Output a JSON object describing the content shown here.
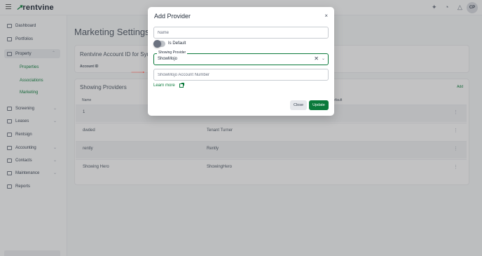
{
  "topbar": {
    "logo": "rentvine",
    "avatar_initials": "CP"
  },
  "sidebar": {
    "items": [
      {
        "label": "Dashboard"
      },
      {
        "label": "Portfolios"
      },
      {
        "label": "Property"
      },
      {
        "label": "Screening"
      },
      {
        "label": "Leases"
      },
      {
        "label": "Rentsign"
      },
      {
        "label": "Accounting"
      },
      {
        "label": "Contacts"
      },
      {
        "label": "Maintenance"
      },
      {
        "label": "Reports"
      }
    ],
    "property_subitems": [
      {
        "label": "Properties"
      },
      {
        "label": "Associations"
      },
      {
        "label": "Marketing"
      }
    ]
  },
  "main": {
    "title": "Marketing Settings",
    "syndication_card": {
      "title": "Rentvine Account ID for Syndic",
      "account_id_label": "Account ID"
    },
    "providers_card": {
      "title": "Showing Providers",
      "add_label": "Add",
      "columns": {
        "name": "Name",
        "default": "efault"
      },
      "rows": [
        {
          "name": "1",
          "provider": ""
        },
        {
          "name": "dwded",
          "provider": "Tenant Turner"
        },
        {
          "name": "rently",
          "provider": "Rently"
        },
        {
          "name": "Showing Hero",
          "provider": "ShowingHero"
        }
      ]
    }
  },
  "modal": {
    "title": "Add Provider",
    "close_icon": "×",
    "name_placeholder": "Name",
    "is_default_label": "Is Default",
    "showing_provider_label": "Showing Provider",
    "showing_provider_value": "ShowMojo",
    "clear_icon": "✕",
    "chevron_icon": "⌄",
    "account_number_placeholder": "ShowMojo Account Number",
    "learn_more_label": "Learn more",
    "close_button": "Close",
    "update_button": "Update"
  },
  "colors": {
    "accent": "#0b7a3b",
    "arrow": "#e0443a"
  }
}
